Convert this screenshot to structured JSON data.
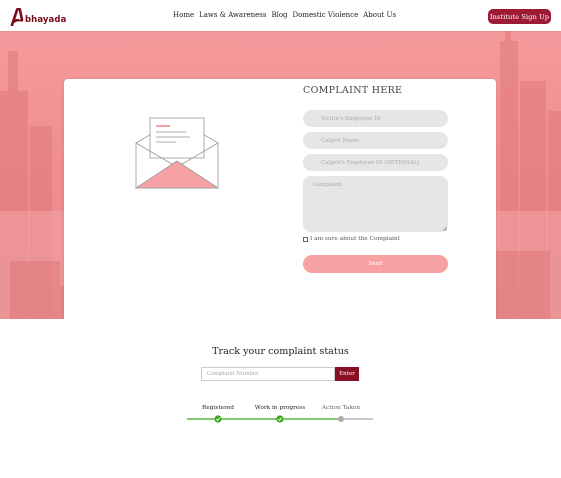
{
  "navbar": {
    "brand": "bhayada",
    "links": [
      "Home",
      "Laws & Awareness",
      "Blog",
      "Domestic Violence",
      "About Us"
    ],
    "signup_label": "Institute Sign Up"
  },
  "complaint_form": {
    "title": "COMPLAINT HERE",
    "victim_id_placeholder": "Victim's Employee ID",
    "culprit_name_placeholder": "Culprit Name",
    "culprit_id_placeholder": "Culprit's Employee ID (OPTIONAL)",
    "complaint_placeholder": "Complaint",
    "confirm_label": "I am sure about the Complaint",
    "confirm_checked": false,
    "send_label": "Send"
  },
  "track": {
    "title": "Track your complaint status",
    "input_placeholder": "Complaint Number",
    "enter_label": "Enter",
    "steps": [
      {
        "label": "Registered",
        "done": true
      },
      {
        "label": "Work in progress",
        "done": true
      },
      {
        "label": "Action Taken",
        "done": false
      }
    ]
  },
  "colors": {
    "brand": "#9c1a33",
    "hero": "#f08e90",
    "done": "#3aa61a",
    "pending": "#aaaaaa"
  }
}
